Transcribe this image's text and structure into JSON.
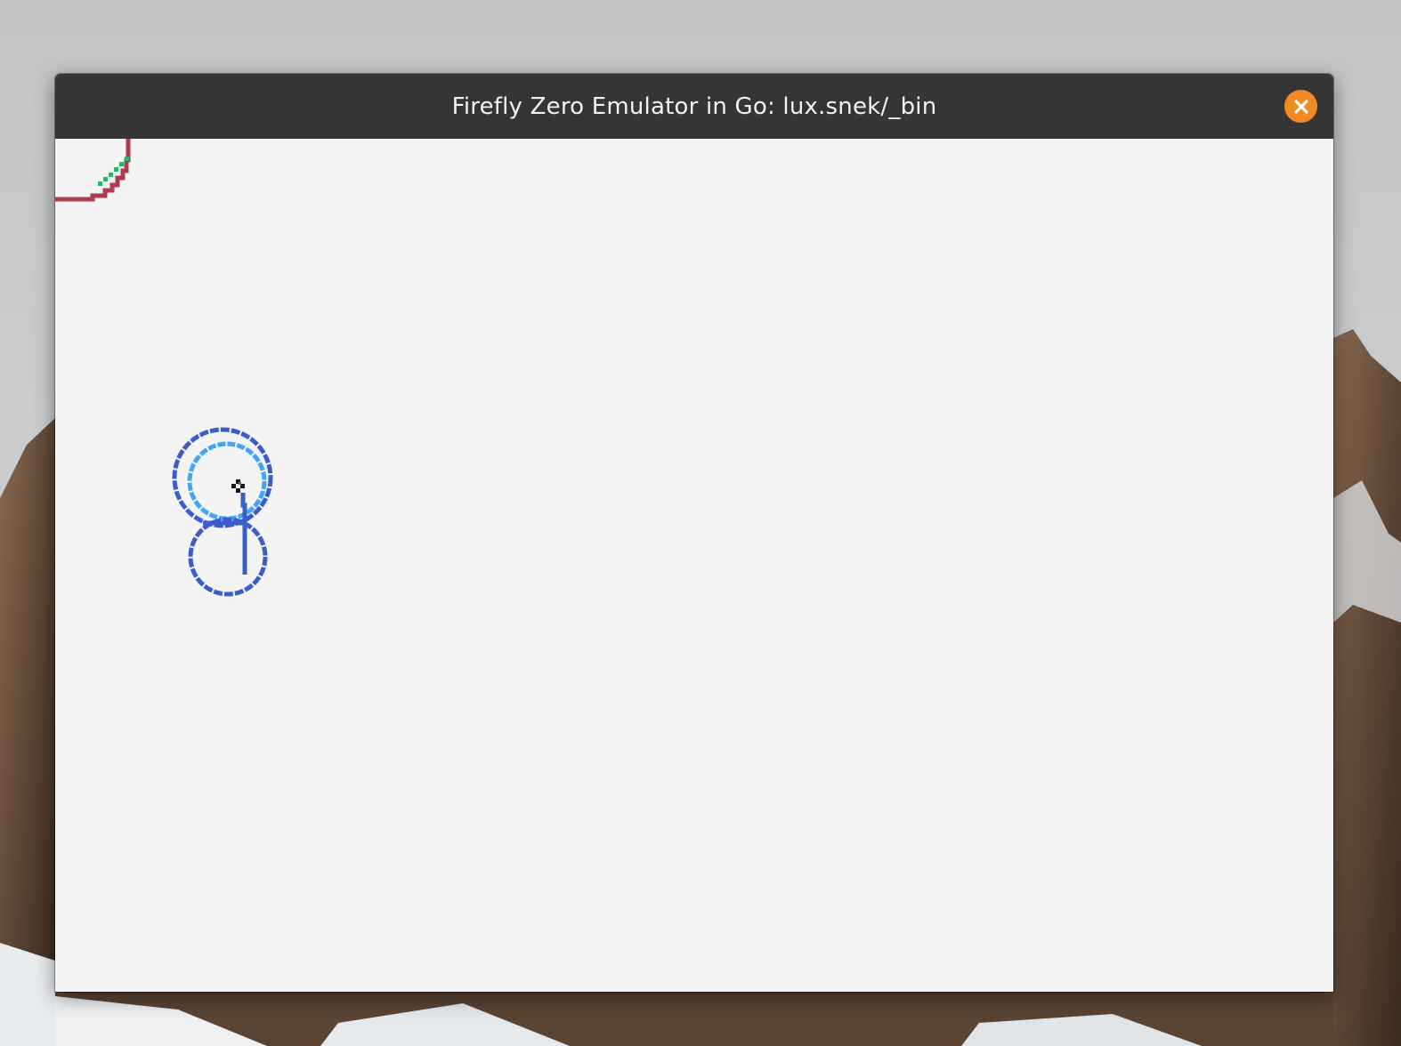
{
  "window": {
    "title": "Firefly Zero Emulator in Go: lux.snek/_bin",
    "close_icon": "close-icon"
  },
  "colors": {
    "titlebar": "#353535",
    "close_button": "#f08a24",
    "screen_background": "#f4f4f4",
    "red_arc": "#b03a4e",
    "green_dots": "#2fb56a",
    "dark_blue": "#3b5dc9",
    "light_blue": "#41a6f6",
    "cursor": "#1a1a1a"
  }
}
